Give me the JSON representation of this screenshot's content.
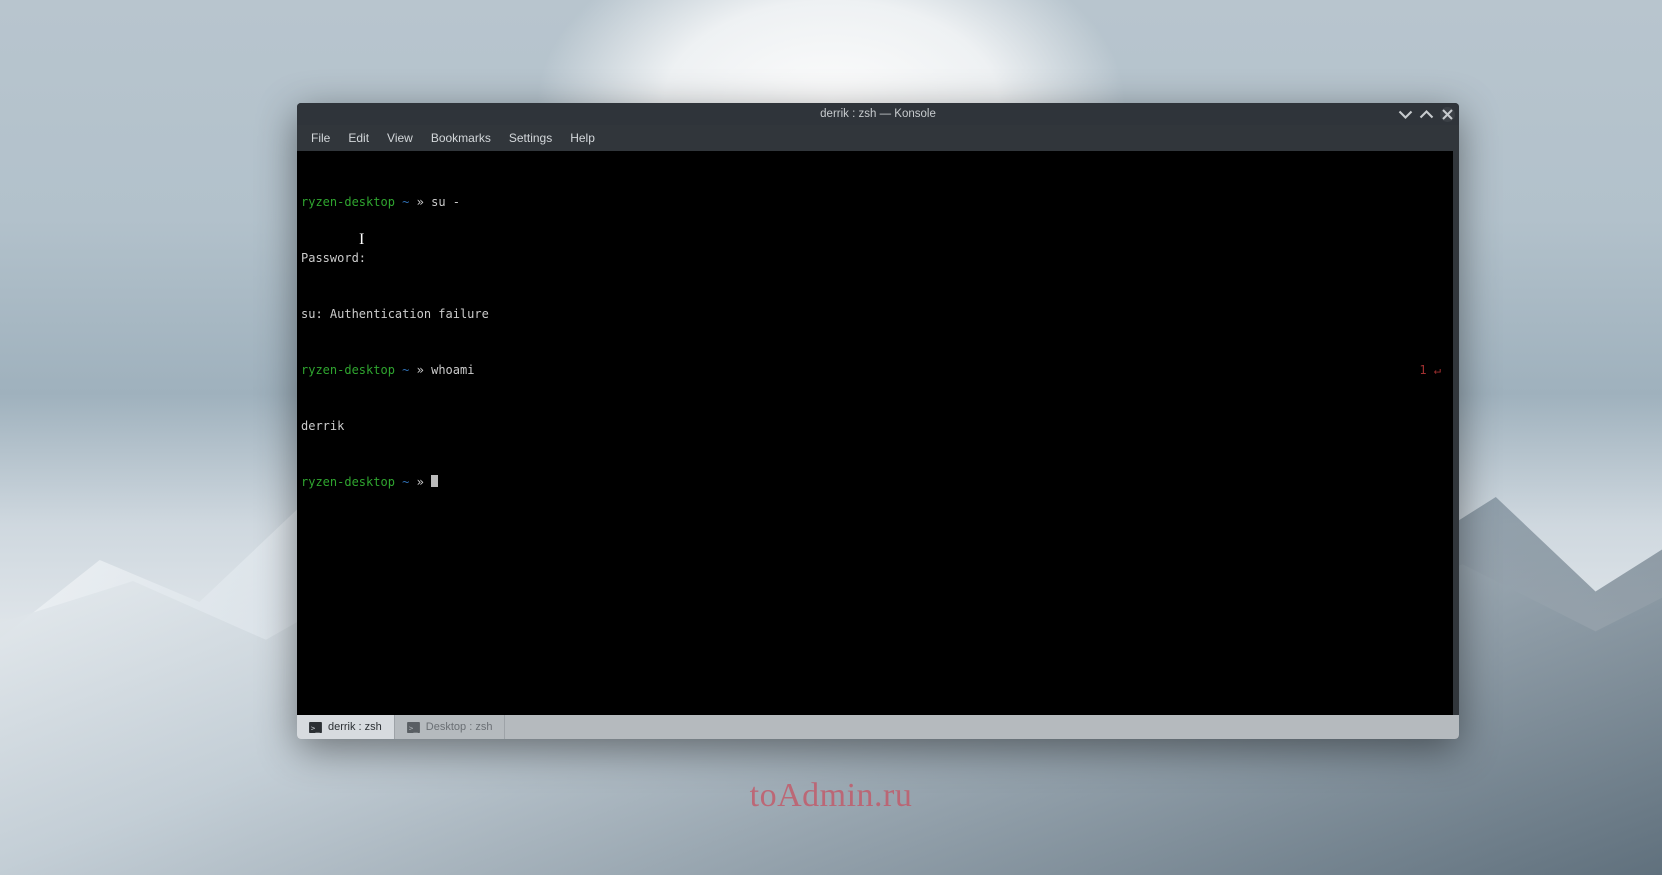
{
  "window": {
    "title": "derrik : zsh — Konsole"
  },
  "menu": {
    "items": [
      "File",
      "Edit",
      "View",
      "Bookmarks",
      "Settings",
      "Help"
    ]
  },
  "terminal": {
    "lines": [
      {
        "host": "ryzen-desktop",
        "path": "~",
        "arrow": "»",
        "cmd": "su -"
      },
      {
        "plain": "Password:"
      },
      {
        "plain": "su: Authentication failure"
      },
      {
        "host": "ryzen-desktop",
        "path": "~",
        "arrow": "»",
        "cmd": "whoami",
        "right_err": "1 ↵"
      },
      {
        "plain": "derrik"
      },
      {
        "host": "ryzen-desktop",
        "path": "~",
        "arrow": "»",
        "cmd": "",
        "cursor": true
      }
    ]
  },
  "tabs": [
    {
      "label": "derrik : zsh",
      "active": true
    },
    {
      "label": "Desktop : zsh",
      "active": false
    }
  ],
  "watermark": "toAdmin.ru"
}
